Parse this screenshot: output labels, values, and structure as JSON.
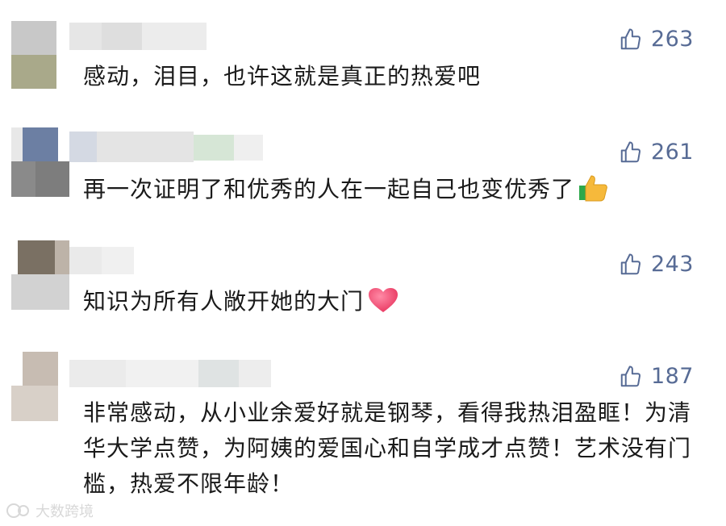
{
  "comments": [
    {
      "likes": "263",
      "text": "感动，泪目，也许这就是真正的热爱吧"
    },
    {
      "likes": "261",
      "text": "再一次证明了和优秀的人在一起自己也变优秀了"
    },
    {
      "likes": "243",
      "text": "知识为所有人敞开她的大门"
    },
    {
      "likes": "187",
      "text": "非常感动，从小业余爱好就是钢琴，看得我热泪盈眶！为清华大学点赞，为阿姨的爱国心和自学成才点赞！艺术没有门槛，热爱不限年龄！"
    }
  ],
  "emojis": [
    "thumbs-up-emoji",
    "heart-emoji"
  ],
  "icons": {
    "like": "thumb-up-outline-icon"
  },
  "colors": {
    "like": "#576b95",
    "text": "#1a1a1a"
  },
  "watermark": {
    "text": "大数跨境"
  }
}
